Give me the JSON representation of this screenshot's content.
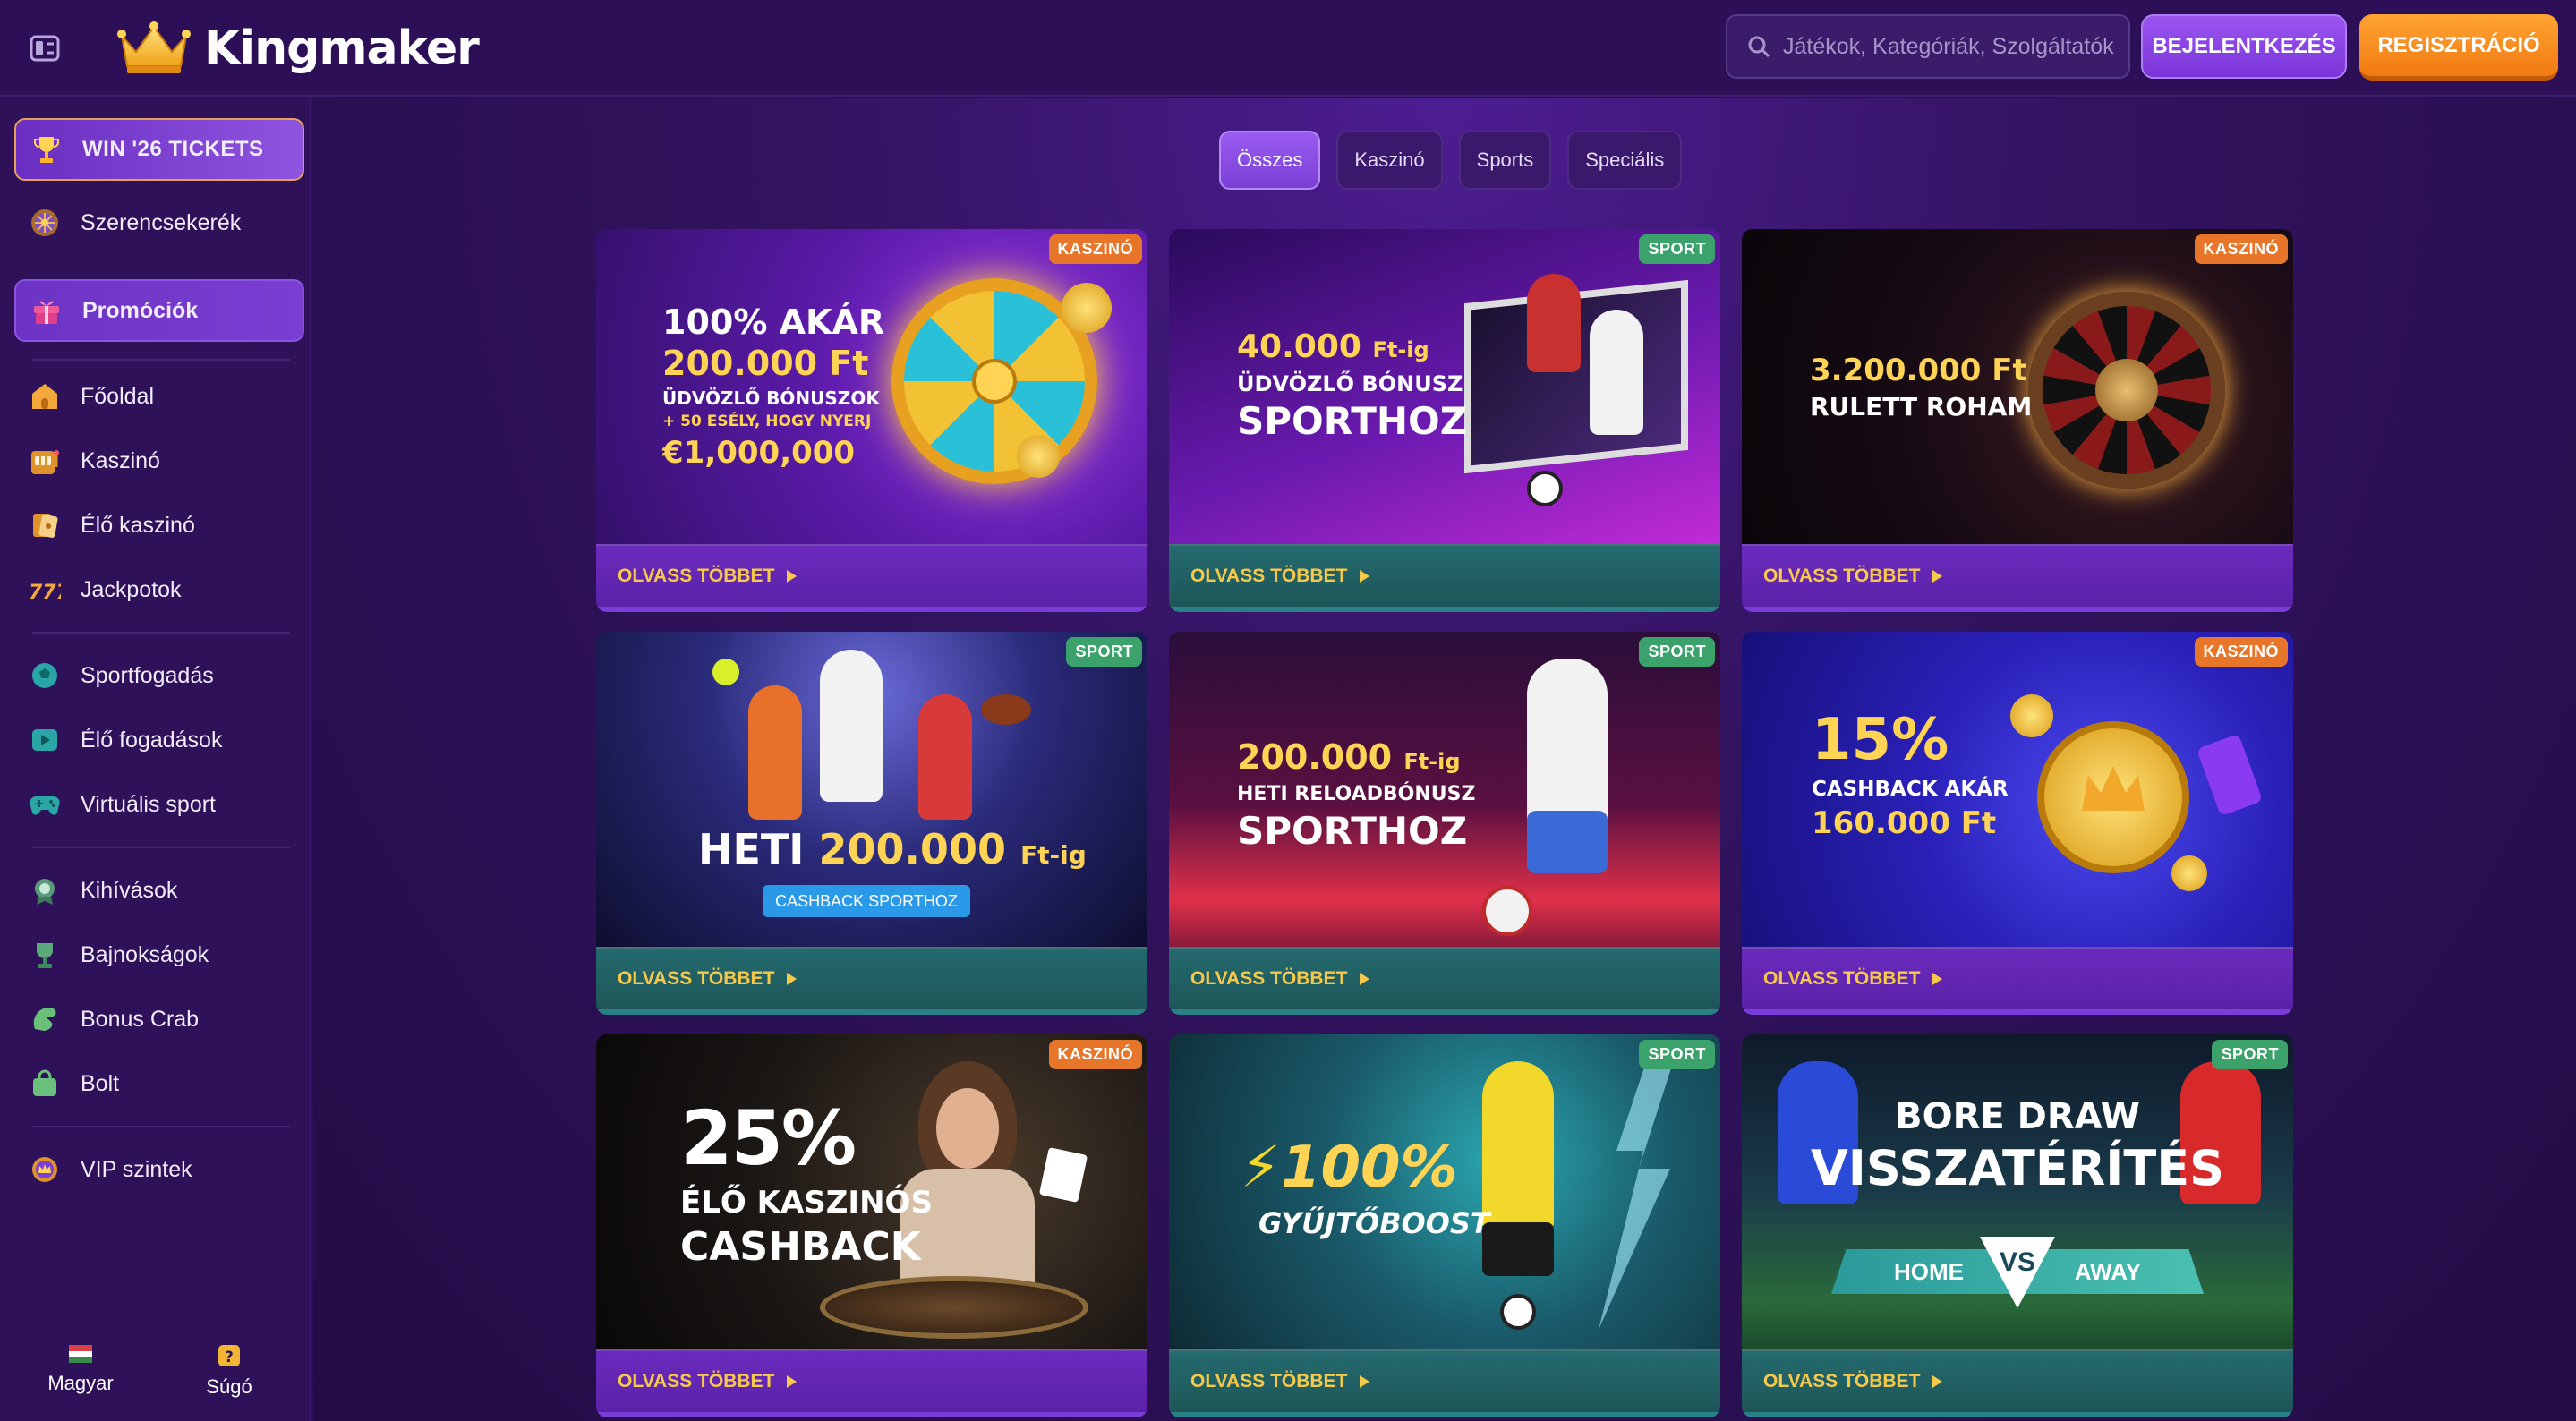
{
  "header": {
    "brand": "Kingmaker",
    "search_placeholder": "Játékok, Kategóriák, Szolgáltatók",
    "login_label": "BEJELENTKEZÉS",
    "register_label": "REGISZTRÁCIÓ"
  },
  "sidebar": {
    "items": [
      {
        "label": "WIN '26 TICKETS",
        "icon": "trophy-icon"
      },
      {
        "label": "Szerencsekerék",
        "icon": "wheel-icon"
      },
      {
        "label": "Promóciók",
        "icon": "gift-icon"
      },
      {
        "label": "Főoldal",
        "icon": "home-icon"
      },
      {
        "label": "Kaszinó",
        "icon": "slot-machine-icon"
      },
      {
        "label": "Élő kaszinó",
        "icon": "cards-icon"
      },
      {
        "label": "Jackpotok",
        "icon": "777-icon"
      },
      {
        "label": "Sportfogadás",
        "icon": "football-icon"
      },
      {
        "label": "Élő fogadások",
        "icon": "live-play-icon"
      },
      {
        "label": "Virtuális sport",
        "icon": "gamepad-icon"
      },
      {
        "label": "Kihívások",
        "icon": "medal-icon"
      },
      {
        "label": "Bajnokságok",
        "icon": "cup-icon"
      },
      {
        "label": "Bonus Crab",
        "icon": "crab-claw-icon"
      },
      {
        "label": "Bolt",
        "icon": "shopping-bag-icon"
      },
      {
        "label": "VIP szintek",
        "icon": "crown-badge-icon"
      }
    ],
    "language_label": "Magyar",
    "help_label": "Súgó"
  },
  "tabs": [
    "Összes",
    "Kaszinó",
    "Sports",
    "Speciális"
  ],
  "read_more_label": "OLVASS TÖBBET",
  "cards": [
    {
      "badge": "KASZINÓ",
      "type": "casino",
      "lines": [
        "100% AKÁR",
        "200.000 Ft",
        "ÜDVÖZLŐ BÓNUSZOK",
        "+ 50 ESÉLY, HOGY NYERJ",
        "€1,000,000"
      ]
    },
    {
      "badge": "SPORT",
      "type": "sport",
      "lines": [
        "40.000",
        "Ft-ig",
        "ÜDVÖZLŐ BÓNUSZ",
        "SPORTHOZ"
      ]
    },
    {
      "badge": "KASZINÓ",
      "type": "casino",
      "lines": [
        "3.200.000 Ft",
        "RULETT ROHAM"
      ]
    },
    {
      "badge": "SPORT",
      "type": "sport",
      "lines": [
        "HETI",
        "200.000",
        "Ft-ig",
        "CASHBACK SPORTHOZ"
      ]
    },
    {
      "badge": "SPORT",
      "type": "sport",
      "lines": [
        "200.000",
        "Ft-ig",
        "HETI RELOADBÓNUSZ",
        "SPORTHOZ"
      ]
    },
    {
      "badge": "KASZINÓ",
      "type": "casino",
      "lines": [
        "15%",
        "CASHBACK AKÁR",
        "160.000 Ft"
      ]
    },
    {
      "badge": "KASZINÓ",
      "type": "casino",
      "lines": [
        "25%",
        "ÉLŐ KASZINÓS",
        "CASHBACK"
      ]
    },
    {
      "badge": "SPORT",
      "type": "sport",
      "lines": [
        "100%",
        "GYŰJTŐBOOST"
      ]
    },
    {
      "badge": "SPORT",
      "type": "sport",
      "lines": [
        "BORE DRAW",
        "VISSZATÉRÍTÉS",
        "HOME",
        "VS",
        "AWAY"
      ]
    }
  ],
  "colors": {
    "accent_purple": "#7a3fd6",
    "accent_orange": "#f07a12",
    "gold": "#ffd454",
    "casino_badge": "#e8762a",
    "sport_badge": "#3aa26a"
  }
}
